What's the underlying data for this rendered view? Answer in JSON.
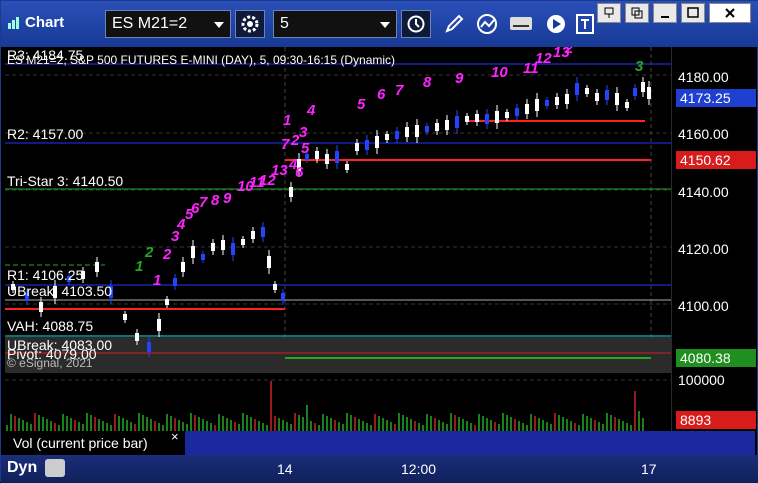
{
  "app": {
    "title": "Chart"
  },
  "toolbar": {
    "symbol": "ES M21=2",
    "interval": "5",
    "icons": [
      "gear-icon",
      "clock-icon",
      "pen-icon",
      "line-study-icon",
      "get-icon",
      "play-icon",
      "text-icon"
    ]
  },
  "window_controls": [
    "restore",
    "minimize",
    "maximize",
    "close"
  ],
  "chart": {
    "header": "ES M21=2, S&P 500 FUTURES E-MINI (DAY), 5, 09:30-16:15 (Dynamic)",
    "copyright": "© eSignal, 2021",
    "y_ticks": [
      "4180.00",
      "4160.00",
      "4140.00",
      "4120.00",
      "4100.00"
    ],
    "price_tags": [
      {
        "value": "4173.25",
        "color": "#1f3fd1"
      },
      {
        "value": "4150.62",
        "color": "#d81b1b"
      },
      {
        "value": "4080.38",
        "color": "#1f8f1f"
      }
    ],
    "levels": [
      {
        "label": "R3: 4184.75"
      },
      {
        "label": "R2: 4157.00"
      },
      {
        "label": "Tri-Star 3: 4140.50"
      },
      {
        "label": "R1: 4106.25"
      },
      {
        "label": "UBreak: 4103.50"
      },
      {
        "label": "VAH: 4088.75"
      },
      {
        "label": "UBreak: 4083.00"
      },
      {
        "label": "Pivot: 4079.00"
      }
    ],
    "count_labels": [
      "1",
      "2",
      "3",
      "4",
      "5",
      "6",
      "7",
      "8",
      "9",
      "10",
      "11",
      "12",
      "13",
      "1",
      "2",
      "3",
      "4",
      "5",
      "6",
      "7",
      "8",
      "9",
      "10",
      "11",
      "12",
      "13",
      "2",
      "3",
      "4",
      "5",
      "6",
      "7",
      "2",
      "1"
    ]
  },
  "volume": {
    "label": "Vol (current price bar)",
    "close_symbol": "×",
    "y_tick": "100000",
    "value_tag": "8893"
  },
  "bottom": {
    "dyn_label": "Dyn",
    "time_ticks": [
      "14",
      "12:00",
      "17"
    ]
  }
}
